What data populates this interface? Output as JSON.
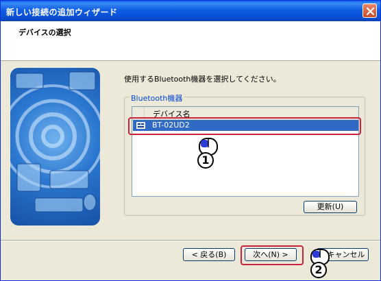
{
  "window": {
    "title": "新しい接続の追加ウィザード"
  },
  "header": {
    "title": "デバイスの選択"
  },
  "main": {
    "instruction": "使用するBluetooth機器を選択してください。",
    "group_label": "Bluetooth機器",
    "list": {
      "column_header": "デバイス名",
      "rows": [
        {
          "name": "BT-02UD2",
          "selected": true
        }
      ]
    },
    "refresh_label": "更新(U)"
  },
  "footer": {
    "back_label": "< 戻る(B)",
    "next_label": "次へ(N) >",
    "cancel_label": "キャンセル"
  },
  "annotations": {
    "step1": "1",
    "step2": "2"
  },
  "colors": {
    "title_bar": "#0a4fd4",
    "selection": "#316ac5",
    "highlight_box": "#c8223c",
    "group_label": "#0046d5"
  },
  "icons": [
    "close-icon",
    "device-icon",
    "mouse-icon",
    "wizard-banner"
  ]
}
